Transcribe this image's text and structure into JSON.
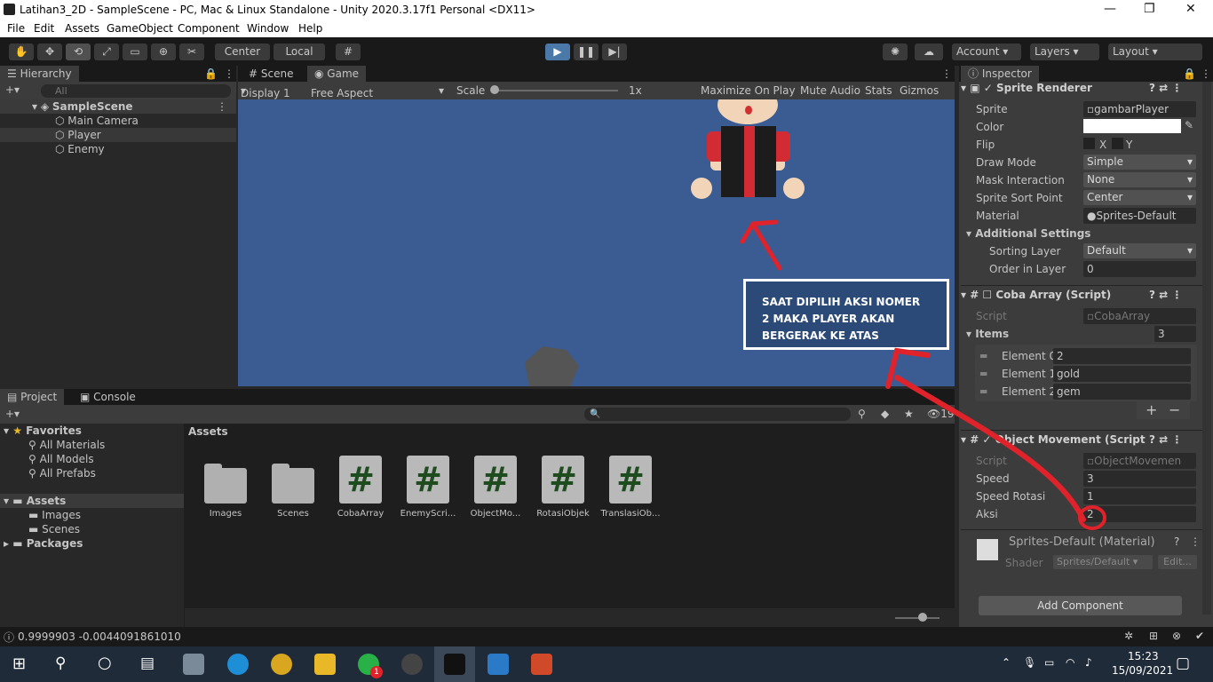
{
  "window": {
    "title": "Latihan3_2D - SampleScene - PC, Mac & Linux Standalone - Unity 2020.3.17f1 Personal <DX11>",
    "min_icon": "minimize-icon",
    "max_icon": "maximize-icon",
    "close_icon": "close-icon"
  },
  "menu": [
    "File",
    "Edit",
    "Assets",
    "GameObject",
    "Component",
    "Window",
    "Help"
  ],
  "toolbar": {
    "center_label": "Center",
    "local_label": "Local",
    "account_label": "Account",
    "layers_label": "Layers",
    "layout_label": "Layout"
  },
  "hierarchy": {
    "tab": "Hierarchy",
    "search_placeholder": "All",
    "scene": "SampleScene",
    "items": [
      "Main Camera",
      "Player",
      "Enemy"
    ]
  },
  "game": {
    "tab_scene": "Scene",
    "tab_game": "Game",
    "display": "Display 1",
    "aspect": "Free Aspect",
    "scale_label": "Scale",
    "scale_value": "1x",
    "maximize": "Maximize On Play",
    "mute": "Mute Audio",
    "stats": "Stats",
    "gizmos": "Gizmos"
  },
  "annotation": {
    "text": "SAAT DIPILIH AKSI NOMER 2 MAKA PLAYER AKAN BERGERAK KE ATAS"
  },
  "project": {
    "tab_project": "Project",
    "tab_console": "Console",
    "count": "19",
    "favorites": "Favorites",
    "fav_items": [
      "All Materials",
      "All Models",
      "All Prefabs"
    ],
    "assets_root": "Assets",
    "asset_children": [
      "Images",
      "Scenes"
    ],
    "packages": "Packages",
    "breadcrumb": "Assets",
    "assets": [
      {
        "label": "Images",
        "kind": "folder"
      },
      {
        "label": "Scenes",
        "kind": "folder"
      },
      {
        "label": "CobaArray",
        "kind": "script"
      },
      {
        "label": "EnemyScri...",
        "kind": "script"
      },
      {
        "label": "ObjectMo...",
        "kind": "script"
      },
      {
        "label": "RotasiObjek",
        "kind": "script"
      },
      {
        "label": "TranslasiOb...",
        "kind": "script"
      }
    ]
  },
  "inspector": {
    "tab": "Inspector",
    "sprite_renderer": {
      "title": "Sprite Renderer",
      "sprite_label": "Sprite",
      "sprite_value": "gambarPlayer",
      "color_label": "Color",
      "flip_label": "Flip",
      "flip_x": "X",
      "flip_y": "Y",
      "draw_mode_label": "Draw Mode",
      "draw_mode": "Simple",
      "mask_label": "Mask Interaction",
      "mask": "None",
      "sort_point_label": "Sprite Sort Point",
      "sort_point": "Center",
      "material_label": "Material",
      "material": "Sprites-Default",
      "additional": "Additional Settings",
      "sorting_layer_label": "Sorting Layer",
      "sorting_layer": "Default",
      "order_label": "Order in Layer",
      "order": "0"
    },
    "coba_array": {
      "title": "Coba Array (Script)",
      "script_label": "Script",
      "script": "CobaArray",
      "items_label": "Items",
      "items_count": "3",
      "elements": [
        {
          "label": "Element 0",
          "value": "2"
        },
        {
          "label": "Element 1",
          "value": "gold"
        },
        {
          "label": "Element 2",
          "value": "gem"
        }
      ],
      "plus": "+",
      "minus": "−"
    },
    "object_movement": {
      "title": "Object Movement (Script",
      "script_label": "Script",
      "script": "ObjectMovemen",
      "speed_label": "Speed",
      "speed": "3",
      "speed_rot_label": "Speed Rotasi",
      "speed_rot": "1",
      "aksi_label": "Aksi",
      "aksi": "2"
    },
    "material": {
      "title": "Sprites-Default (Material)",
      "shader_label": "Shader",
      "shader": "Sprites/Default",
      "edit": "Edit..."
    },
    "add_component": "Add Component"
  },
  "status": {
    "text": "0.9999903 -0.0044091861010"
  },
  "taskbar": {
    "time": "15:23",
    "date": "15/09/2021",
    "badge": "1"
  },
  "colors": {
    "accent": "#4a78a8",
    "game_bg": "#3a5c92",
    "annotation_bg": "#2c4a78",
    "red_arrow": "#e0222a"
  }
}
